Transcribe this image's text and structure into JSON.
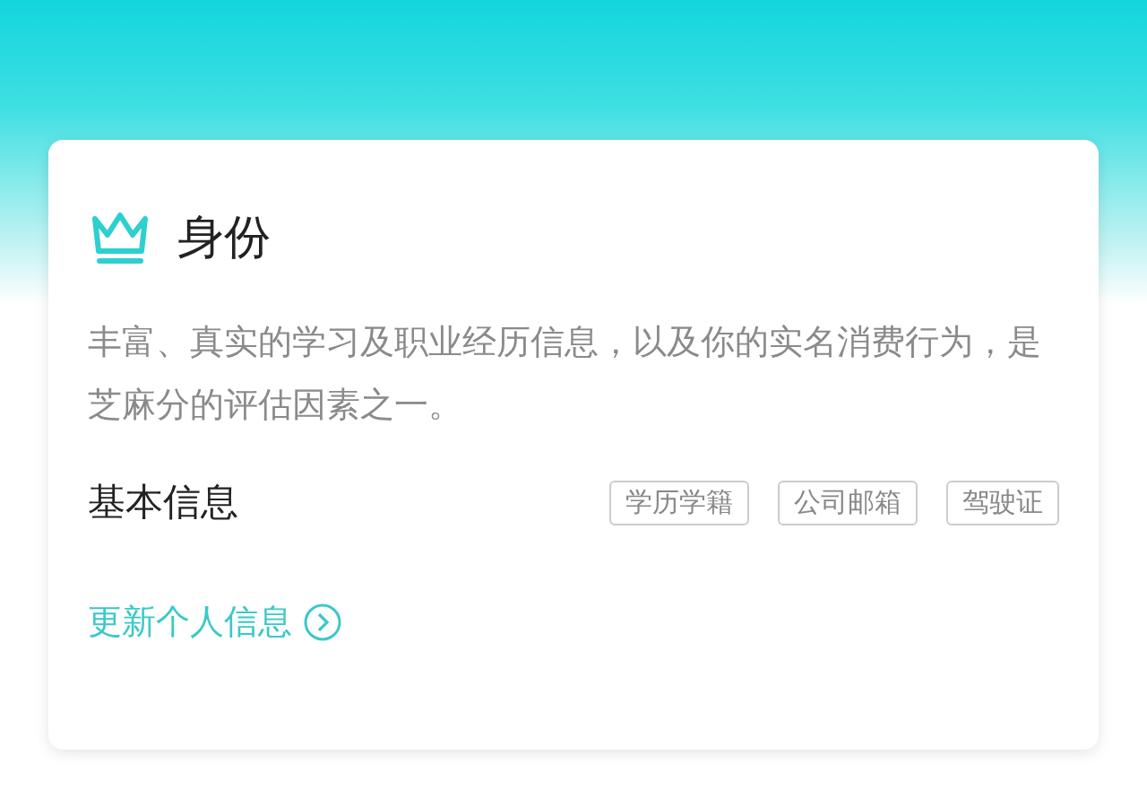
{
  "card": {
    "title": "身份",
    "description": "丰富、真实的学习及职业经历信息，以及你的实名消费行为，是芝麻分的评估因素之一。",
    "section_label": "基本信息",
    "tags": [
      "学历学籍",
      "公司邮箱",
      "驾驶证"
    ],
    "link": "更新个人信息"
  }
}
